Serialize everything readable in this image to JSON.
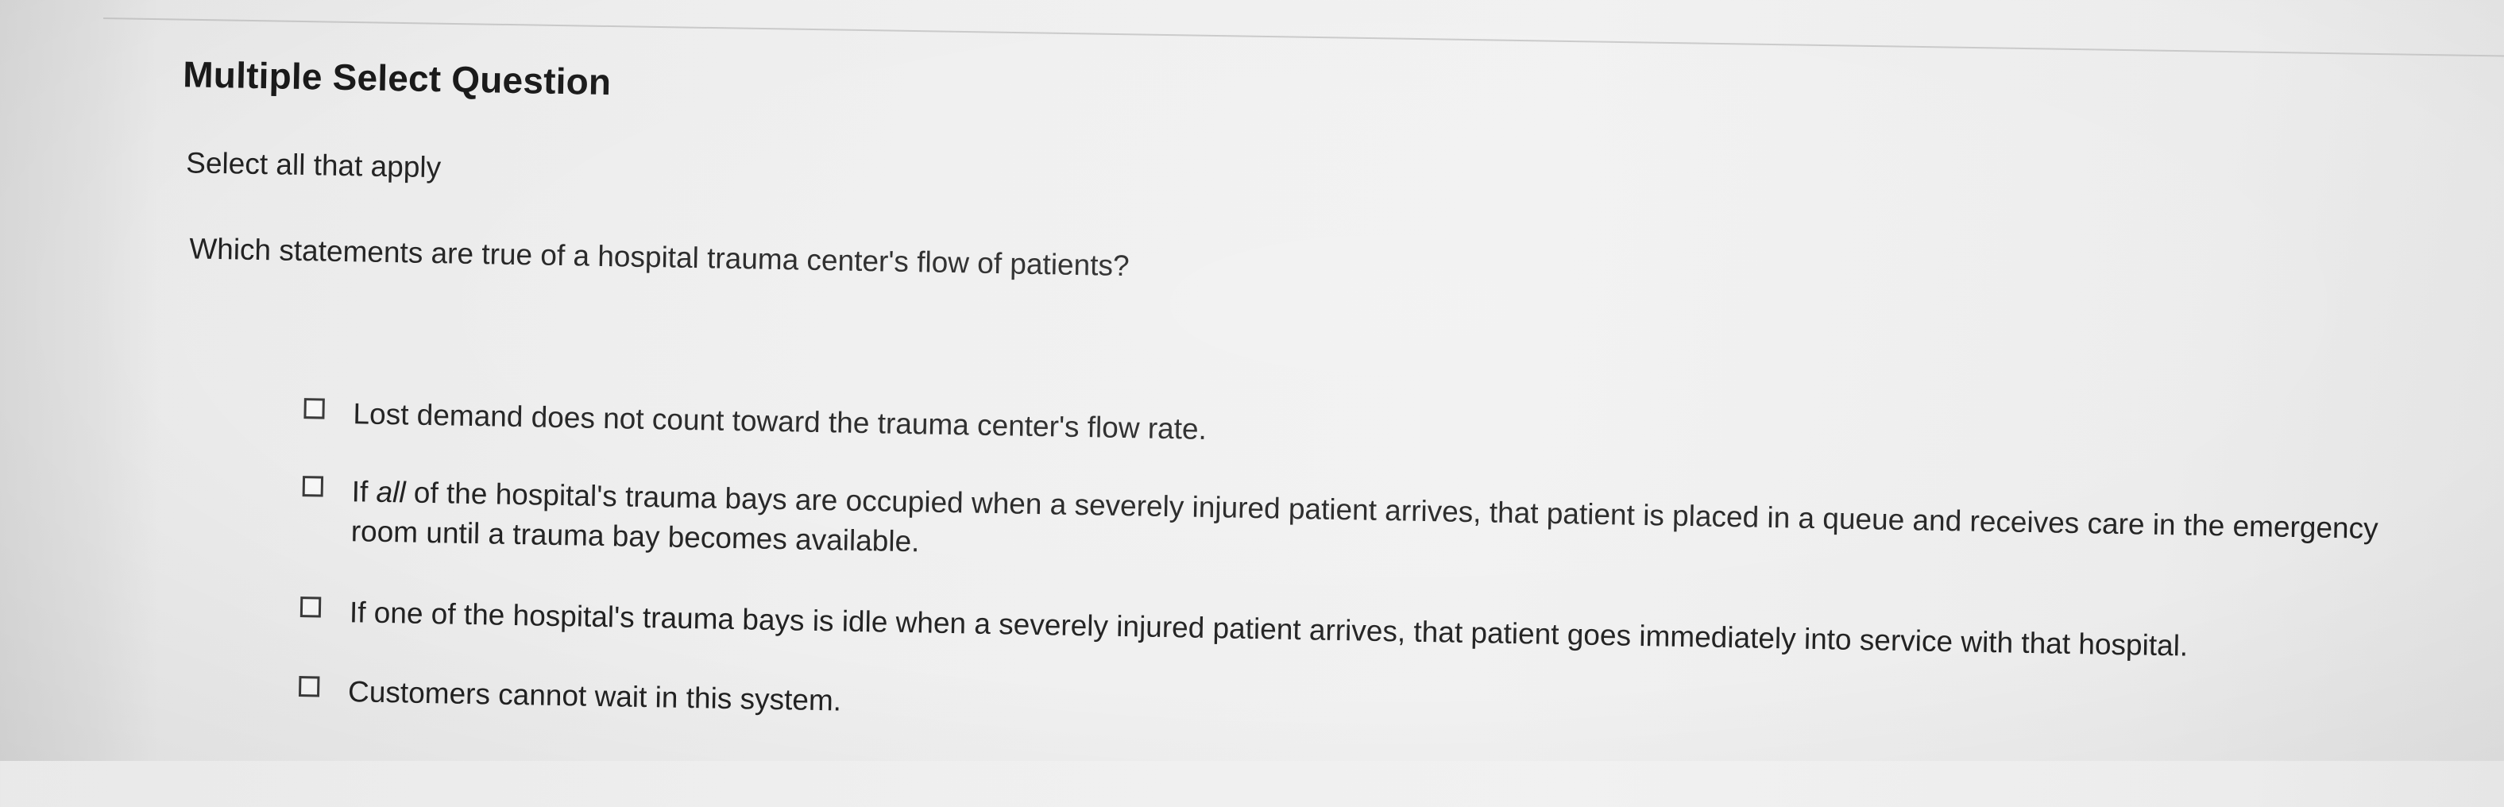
{
  "question": {
    "type_label": "Multiple Select Question",
    "instruction": "Select all that apply",
    "prompt": "Which statements are true of a hospital trauma center's flow of patients?"
  },
  "options": [
    {
      "text": "Lost demand does not count toward the trauma center's flow rate.",
      "checked": false
    },
    {
      "text_before": "If ",
      "text_emphasis": "all",
      "text_after": " of the hospital's trauma bays are occupied when a severely injured patient arrives, that patient is placed in a queue and receives care in the emergency room until a trauma bay becomes available.",
      "checked": false
    },
    {
      "text": "If one of the hospital's trauma bays is idle when a severely injured patient arrives, that patient goes immediately into service with that hospital.",
      "checked": false
    },
    {
      "text": "Customers cannot wait in this system.",
      "checked": false
    }
  ]
}
